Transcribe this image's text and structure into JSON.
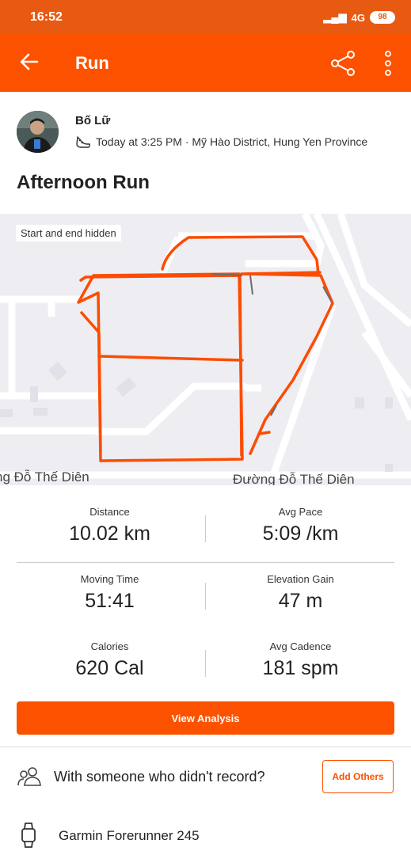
{
  "status_bar": {
    "time": "16:52",
    "network": "4G",
    "battery": "98"
  },
  "app_bar": {
    "title": "Run"
  },
  "athlete": {
    "name": "Bố Lữ"
  },
  "activity": {
    "meta": "Today at 3:25 PM · Mỹ Hào District, Hung Yen Province",
    "title": "Afternoon Run"
  },
  "map": {
    "privacy_tag": "Start and end hidden",
    "street_left": "ng Đỗ Thế Diên",
    "street_right": "Đường Đỗ Thế Diên",
    "route_color": "#fc4c02"
  },
  "stats": [
    {
      "label": "Distance",
      "value": "10.02 km"
    },
    {
      "label": "Avg Pace",
      "value": "5:09 /km"
    },
    {
      "label": "Moving Time",
      "value": "51:41"
    },
    {
      "label": "Elevation Gain",
      "value": "47 m"
    },
    {
      "label": "Calories",
      "value": "620 Cal"
    },
    {
      "label": "Avg Cadence",
      "value": "181 spm"
    }
  ],
  "buttons": {
    "view_analysis": "View Analysis",
    "add_others": "Add Others"
  },
  "others": {
    "prompt": "With someone who didn't record?"
  },
  "device": {
    "name": "Garmin Forerunner 245"
  },
  "colors": {
    "brand": "#fc5200",
    "status_bar": "#e85a12"
  },
  "icons": [
    "back-arrow-icon",
    "share-icon",
    "more-vertical-icon",
    "shoe-icon",
    "group-icon",
    "watch-icon"
  ]
}
